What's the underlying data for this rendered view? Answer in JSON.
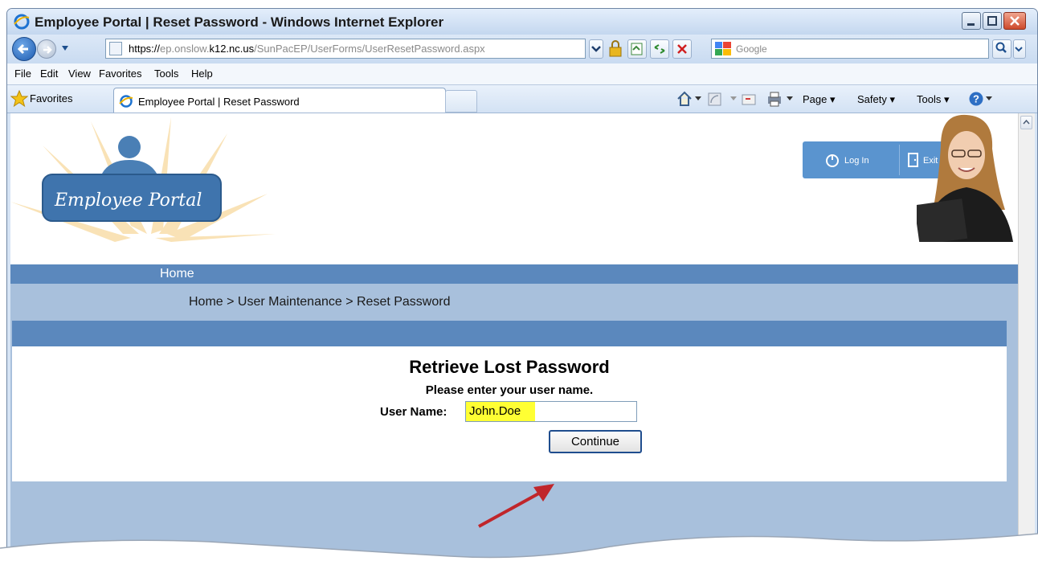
{
  "window": {
    "title": "Employee Portal | Reset Password - Windows Internet Explorer"
  },
  "address_bar": {
    "url_prefix": "https://",
    "url_subdomain": "ep.onslow.",
    "url_host": "k12.nc.us",
    "url_path": "/SunPacEP/UserForms/UserResetPassword.aspx",
    "search_placeholder": "Google"
  },
  "menu": [
    "File",
    "Edit",
    "View",
    "Favorites",
    "Tools",
    "Help"
  ],
  "favorites_bar": {
    "favorites_label": "Favorites",
    "tab_title": "Employee Portal | Reset Password",
    "commands": [
      "Page ▾",
      "Safety ▾",
      "Tools ▾"
    ]
  },
  "page": {
    "logo_text": "Employee Portal",
    "login_label": "Log In",
    "exit_label": "Exit",
    "nav_home": "Home",
    "breadcrumb": "Home > User Maintenance > Reset Password",
    "form": {
      "title": "Retrieve Lost Password",
      "subtitle": "Please enter your user name.",
      "username_label": "User Name:",
      "username_value": "John.Doe",
      "continue_label": "Continue"
    }
  },
  "colors": {
    "nav_blue": "#5b88bd",
    "crumb_blue": "#a8c0dc",
    "highlight": "#ffff33",
    "arrow_red": "#c0262b"
  }
}
